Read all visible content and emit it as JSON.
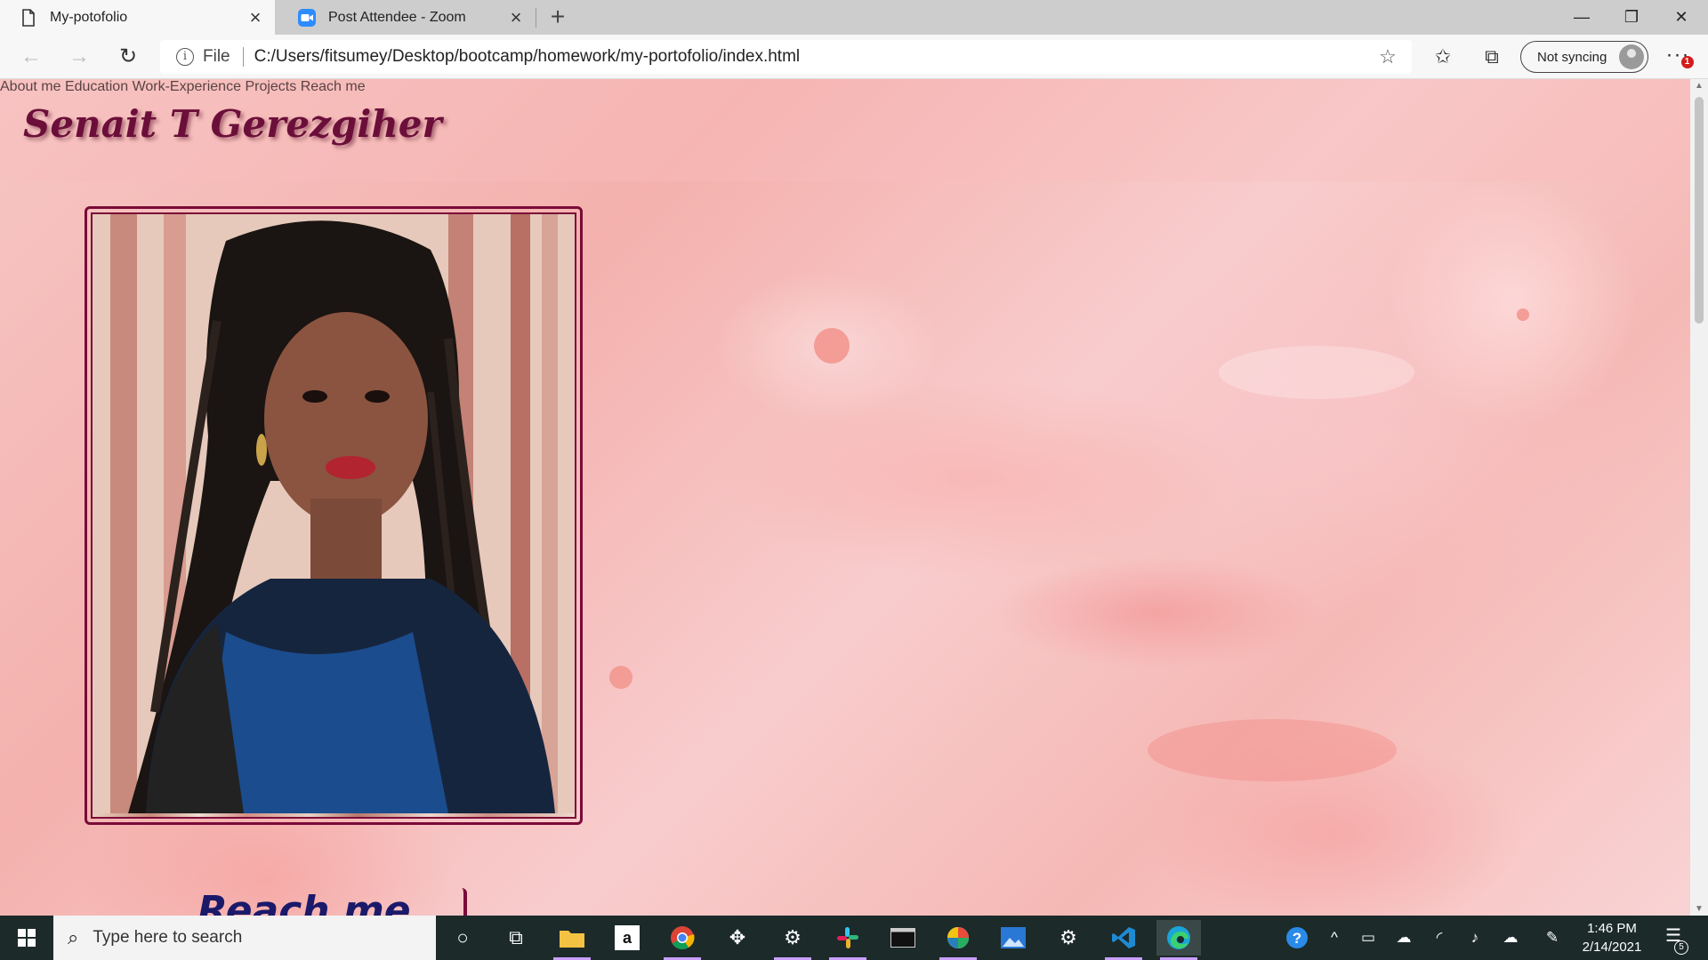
{
  "browser": {
    "tabs": [
      {
        "title": "My-potofolio",
        "icon": "page-icon",
        "active": true
      },
      {
        "title": "Post Attendee - Zoom",
        "icon": "zoom-icon",
        "active": false
      }
    ],
    "address": {
      "scheme_label": "File",
      "url": "C:/Users/fitsumey/Desktop/bootcamp/homework/my-portofolio/index.html"
    },
    "sync_label": "Not syncing",
    "menu_badge": "1"
  },
  "page": {
    "site_title": "Senait T Gerezgiher",
    "nav": [
      "About me",
      "Education",
      "Work-Experience",
      "Projects",
      "Reach me"
    ],
    "section_heading": "Reach me",
    "colors": {
      "accent": "#7a0a38",
      "nav_text": "#1b1a6a",
      "title_text": "#6b0f3a"
    }
  },
  "taskbar": {
    "search_placeholder": "Type here to search",
    "apps": [
      "cortana-icon",
      "task-view-icon",
      "file-explorer-icon",
      "amazon-icon",
      "chrome-icon",
      "dropbox-icon",
      "settings-icon",
      "slack-icon",
      "terminal-icon",
      "photos-app-icon",
      "photos-icon",
      "tools-icon",
      "vscode-icon",
      "edge-icon"
    ],
    "time": "1:46 PM",
    "date": "2/14/2021",
    "notification_count": "5"
  }
}
